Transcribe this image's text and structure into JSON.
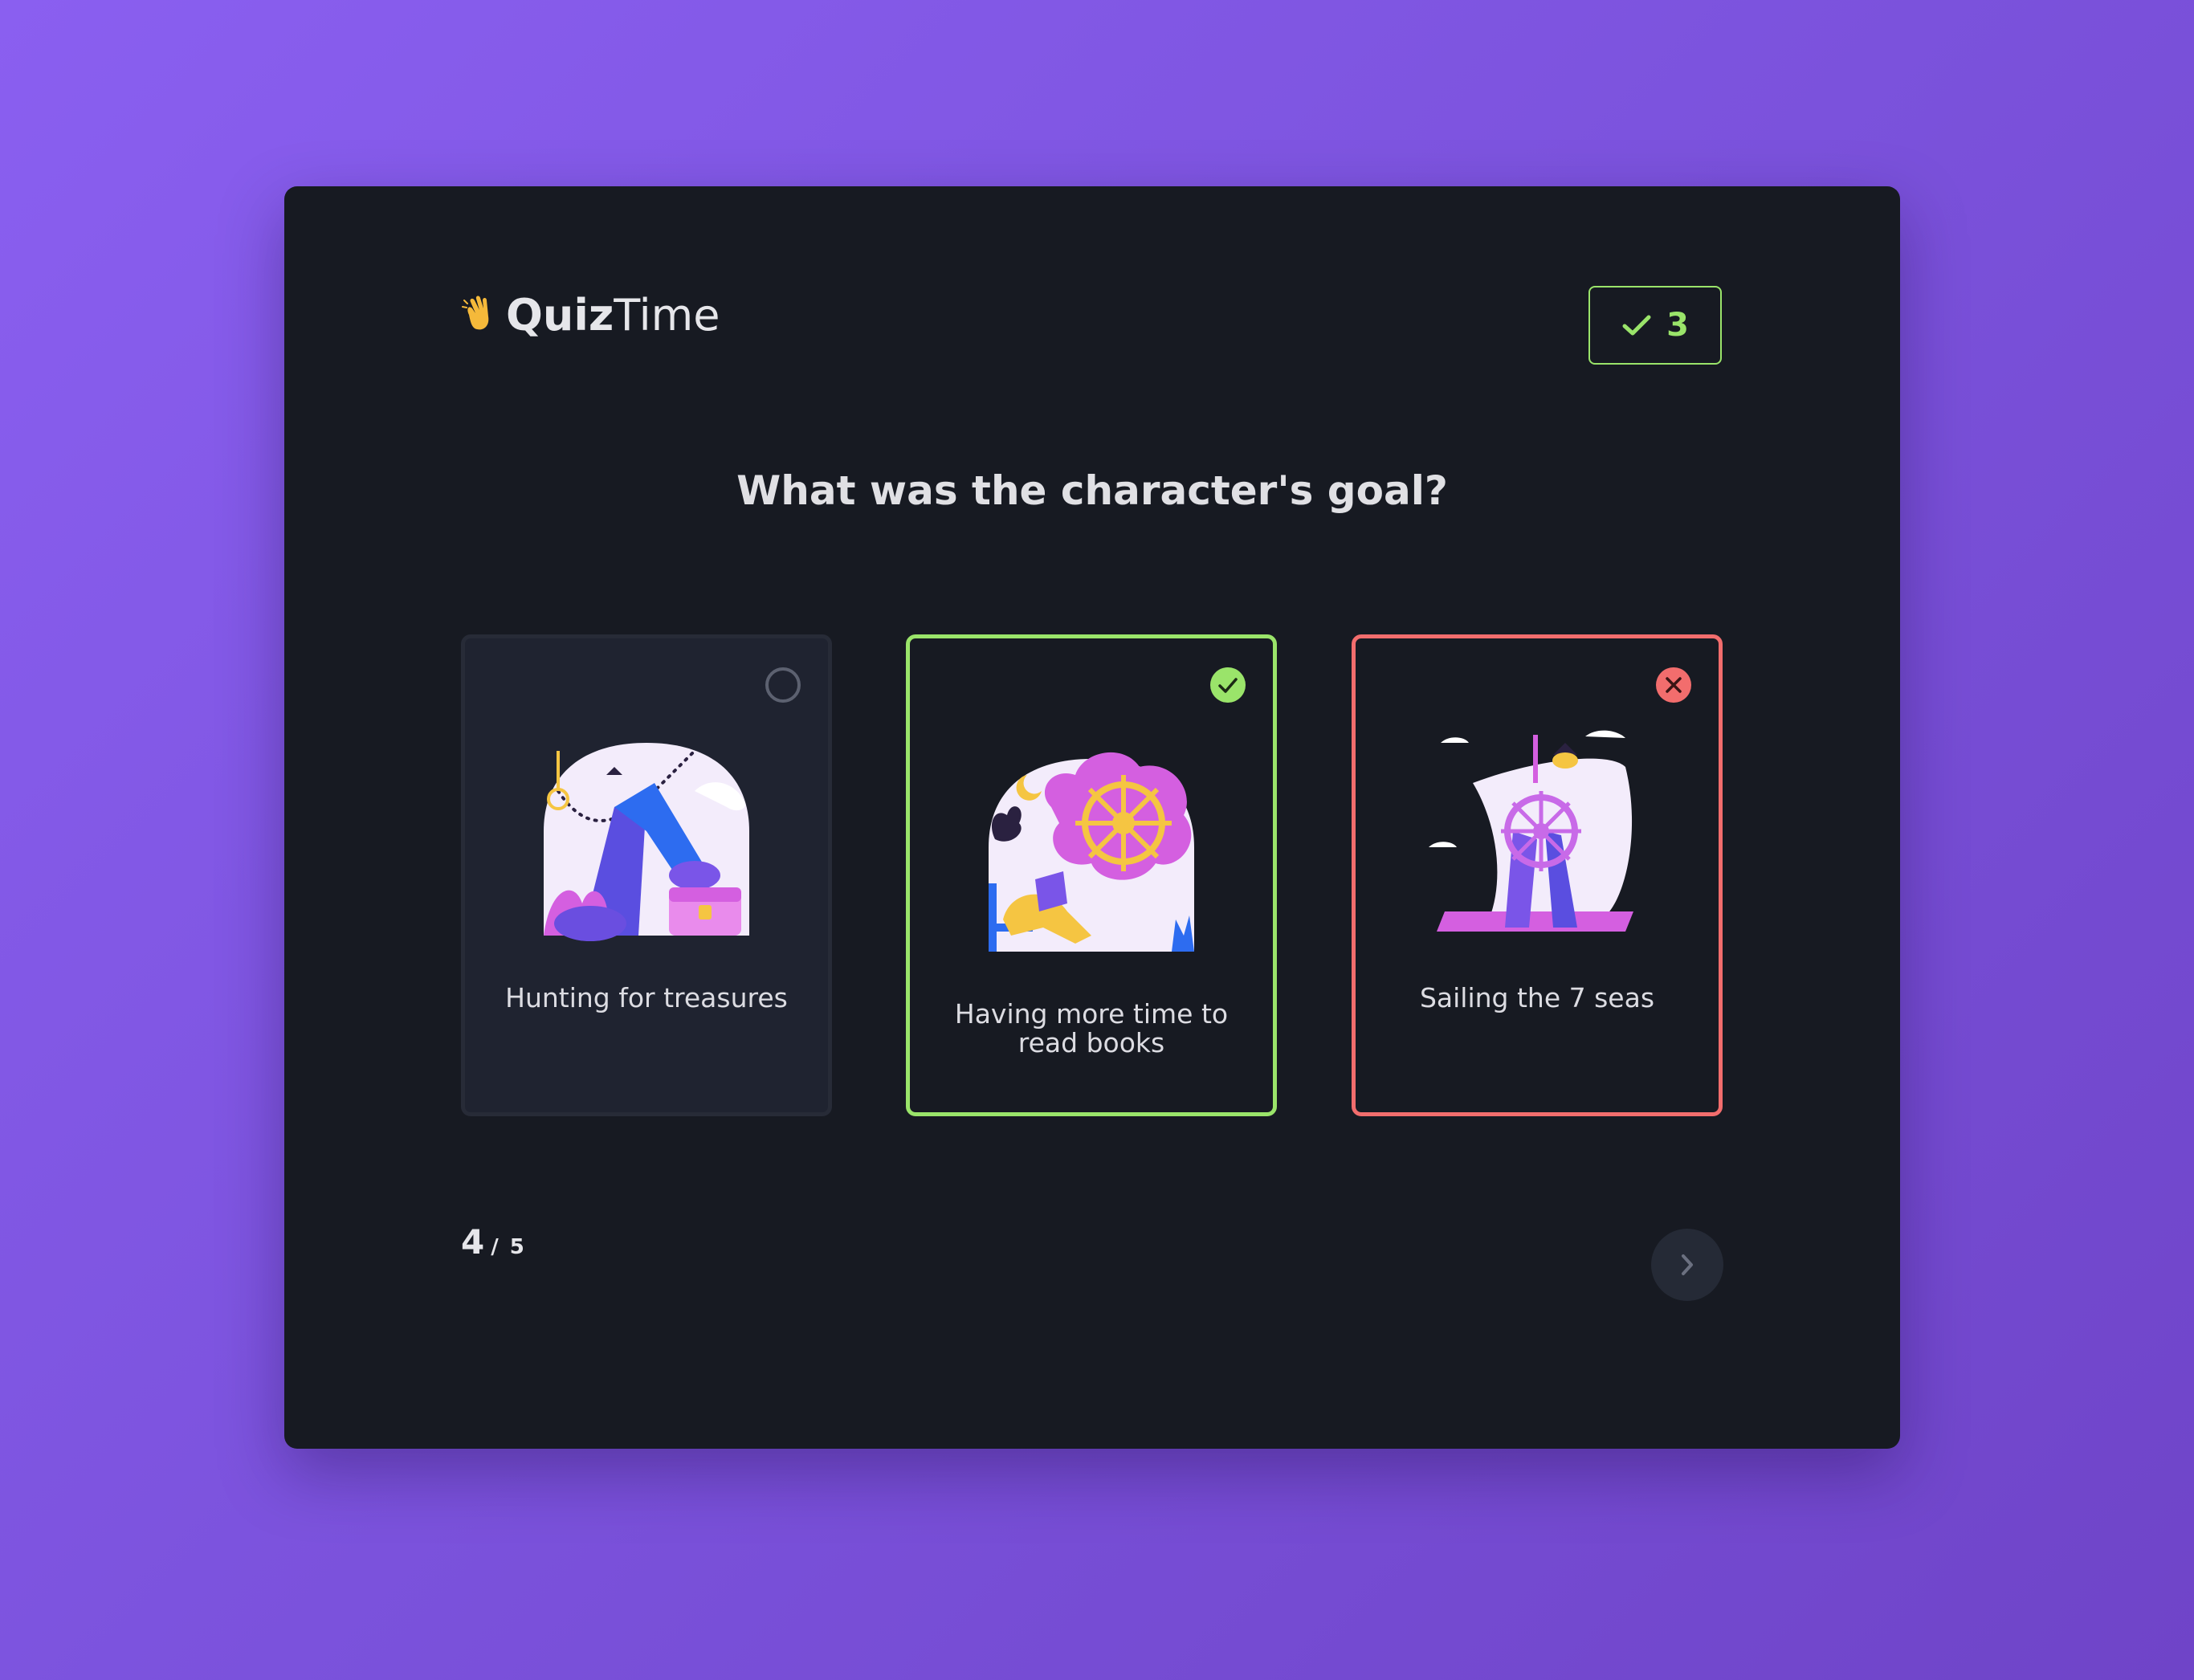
{
  "app": {
    "logo_bold": "Quiz",
    "logo_light": "Time",
    "logo_icon": "waving-hand-icon"
  },
  "score": {
    "icon": "check-icon",
    "value": "3",
    "color": "#9ae46a"
  },
  "question": {
    "text": "What was the character's goal?"
  },
  "answers": [
    {
      "label": "Hunting for treasures",
      "state": "unselected",
      "icon": "empty-radio-icon"
    },
    {
      "label": "Having more time to read books",
      "state": "correct",
      "icon": "check-circle-icon"
    },
    {
      "label": "Sailing the 7 seas",
      "state": "incorrect",
      "icon": "x-circle-icon"
    }
  ],
  "progress": {
    "current": "4",
    "separator": "/",
    "total": "5"
  },
  "navigation": {
    "next_icon": "chevron-right-icon"
  },
  "colors": {
    "correct": "#9ae46a",
    "incorrect": "#f26d6d",
    "panel": "#171a22",
    "background": "#8a5ff0"
  }
}
